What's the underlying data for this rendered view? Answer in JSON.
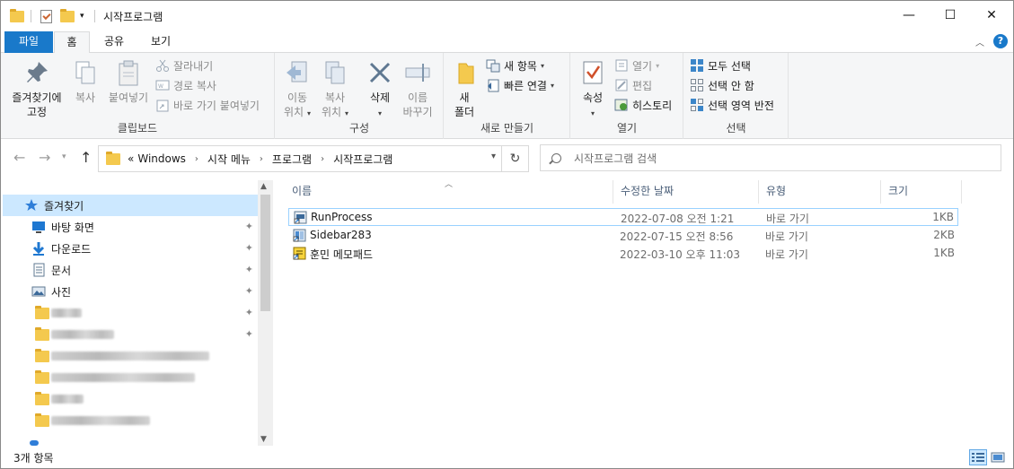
{
  "window": {
    "title": "시작프로그램",
    "minimize_glyph": "—",
    "maximize_glyph": "☐",
    "close_glyph": "✕"
  },
  "tabs": [
    {
      "label": "파일"
    },
    {
      "label": "홈"
    },
    {
      "label": "공유"
    },
    {
      "label": "보기"
    }
  ],
  "ribbon": {
    "clipboard": {
      "group_label": "클립보드",
      "pin_label_1": "즐겨찾기에",
      "pin_label_2": "고정",
      "copy_label": "복사",
      "paste_label": "붙여넣기",
      "cut_label": "잘라내기",
      "copy_path_label": "경로 복사",
      "paste_shortcut_label": "바로 가기 붙여넣기"
    },
    "organize": {
      "group_label": "구성",
      "move_label_1": "이동",
      "move_label_2": "위치",
      "copyto_label_1": "복사",
      "copyto_label_2": "위치",
      "delete_label": "삭제",
      "rename_label_1": "이름",
      "rename_label_2": "바꾸기"
    },
    "new": {
      "group_label": "새로 만들기",
      "new_folder_label_1": "새",
      "new_folder_label_2": "폴더",
      "new_item_label": "새 항목",
      "easy_access_label": "빠른 연결"
    },
    "open": {
      "group_label": "열기",
      "properties_label": "속성",
      "open_label": "열기",
      "edit_label": "편집",
      "history_label": "히스토리"
    },
    "select": {
      "group_label": "선택",
      "select_all_label": "모두 선택",
      "select_none_label": "선택 안 함",
      "invert_label": "선택 영역 반전"
    }
  },
  "address": {
    "overflow": "«",
    "crumbs": [
      "Windows",
      "시작 메뉴",
      "프로그램",
      "시작프로그램"
    ],
    "refresh_glyph": "↻"
  },
  "search": {
    "placeholder": "시작프로그램 검색"
  },
  "nav": {
    "quick_access": "즐겨찾기",
    "items": [
      {
        "label": "바탕 화면",
        "icon": "desktop-icon",
        "pinned": true
      },
      {
        "label": "다운로드",
        "icon": "download-icon",
        "pinned": true
      },
      {
        "label": "문서",
        "icon": "document-icon",
        "pinned": true
      },
      {
        "label": "사진",
        "icon": "pictures-icon",
        "pinned": true
      }
    ],
    "pin_glyph": "📌"
  },
  "columns": {
    "name": "이름",
    "modified": "수정한 날짜",
    "type": "유형",
    "size": "크기"
  },
  "files": [
    {
      "name": "RunProcess",
      "modified": "2022-07-08 오전 1:21",
      "type": "바로 가기",
      "size": "1KB",
      "icon": "shortcut-app-icon"
    },
    {
      "name": "Sidebar283",
      "modified": "2022-07-15 오전 8:56",
      "type": "바로 가기",
      "size": "2KB",
      "icon": "shortcut-app-icon"
    },
    {
      "name": "훈민 메모패드",
      "modified": "2022-03-10 오후 11:03",
      "type": "바로 가기",
      "size": "1KB",
      "icon": "notepad-shortcut-icon"
    }
  ],
  "status": {
    "item_count": "3개 항목"
  },
  "colors": {
    "accent": "#1979ca",
    "selection": "#cce8ff",
    "folder": "#f4c94e"
  }
}
